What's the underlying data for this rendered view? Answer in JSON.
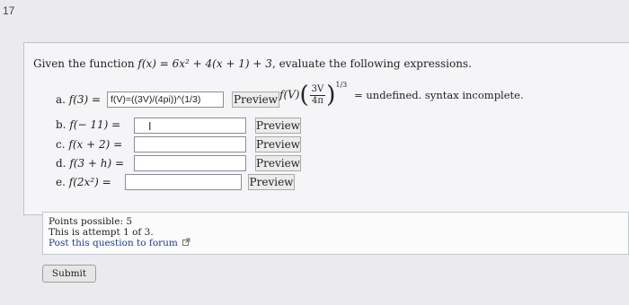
{
  "question_number": "17",
  "prompt": {
    "lead": "Given the function",
    "function": "f(x) = 6x² + 4(x + 1) + 3",
    "tail": ", evaluate the following expressions."
  },
  "parts": [
    {
      "label": "a.",
      "expr": "f(3) =",
      "value": "f(V)=((3V)/(4pi))^(1/3)",
      "button": "Preview"
    },
    {
      "label": "b.",
      "expr": "f(− 11) =",
      "value": "",
      "button": "Preview"
    },
    {
      "label": "c.",
      "expr": "f(x + 2) =",
      "value": "",
      "button": "Preview"
    },
    {
      "label": "d.",
      "expr": "f(3 + h) =",
      "value": "",
      "button": "Preview"
    },
    {
      "label": "e.",
      "expr": "f(2x²) =",
      "value": "",
      "button": "Preview"
    }
  ],
  "preview_result": {
    "lhs": "f(V)",
    "numerator": "3V",
    "denominator": "4π",
    "exponent": "1/3",
    "message": "= undefined. syntax incomplete."
  },
  "info": {
    "points": "Points possible: 5",
    "attempt": "This is attempt 1 of 3.",
    "forum": "Post this question to forum"
  },
  "submit_label": "Submit",
  "icons": {
    "forum_link": "external-link-icon",
    "text_cursor": "i-beam-cursor-icon"
  }
}
